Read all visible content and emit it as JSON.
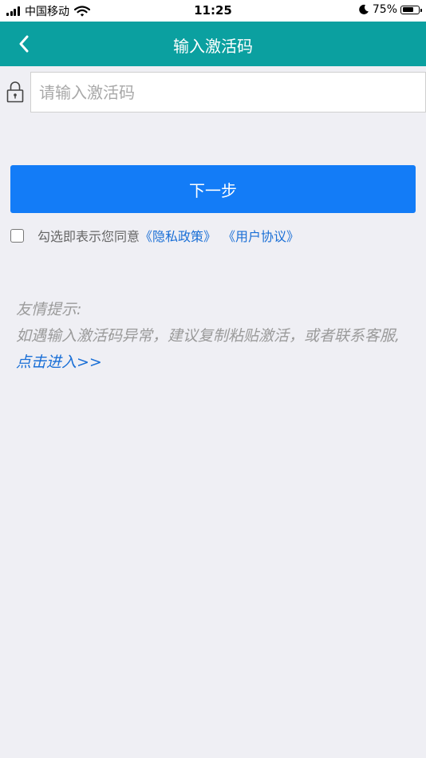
{
  "status_bar": {
    "carrier": "中国移动",
    "time": "11:25",
    "battery_percent": "75%",
    "battery_level": 0.75
  },
  "nav": {
    "title": "输入激活码",
    "back_icon": "chevron-left-icon",
    "color": "#0ba0a0"
  },
  "activation": {
    "lock_icon": "lock-icon",
    "input_placeholder": "请输入激活码",
    "input_value": ""
  },
  "actions": {
    "next_label": "下一步",
    "next_color": "#137cf7"
  },
  "agreement": {
    "checked": false,
    "text": "勾选即表示您同意",
    "privacy_link": "《隐私政策》",
    "terms_link": "《用户协议》"
  },
  "tips": {
    "heading": "友情提示:",
    "body": "如遇输入激活码异常，建议复制粘贴激活，或者联系客服,",
    "link": "点击进入>>"
  }
}
